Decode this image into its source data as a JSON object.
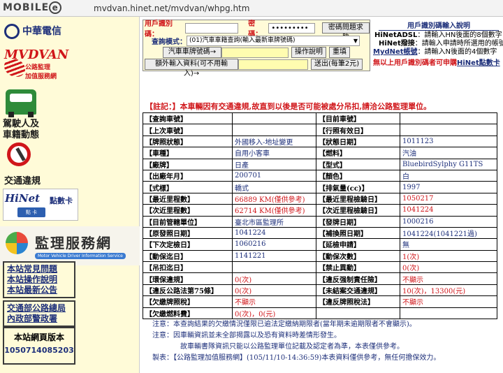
{
  "browser": {
    "logo_text": "MOBILE",
    "logo_mark": "e",
    "url": "mvdvan.hinet.net/mvdvan/whpg.htm"
  },
  "sidebar": {
    "cht_logo": "中華電信",
    "mvdvan": {
      "title": "MVDVAN",
      "sub1": "公路監理",
      "sub2": "加值服務網"
    },
    "driver_label": [
      "駕駛人及",
      "車籍動態"
    ],
    "traffic_label": "交通違規",
    "hinet": {
      "name": "HiNet",
      "points": "點數卡",
      "card": "點 卡"
    },
    "service": {
      "title": "監理服務網",
      "en": "Motor Vehicle Driver Information Service"
    },
    "links_1": [
      "本站常見問題",
      "本站操作說明",
      "本站最新公告"
    ],
    "links_2": [
      "交通部公路總局",
      "內政部警政署"
    ],
    "version": {
      "title": "本站網頁版本",
      "value": "1050714085203"
    }
  },
  "form": {
    "user_id_label": "用戶識別碼：",
    "user_id_value": "",
    "password_label": "密碼：",
    "password_value": "•••••••••",
    "hint_button": "密碼問題求助",
    "mode_label": "查詢模式：",
    "mode_value": "(01)汽車車籍查詢(輸入最新車牌號碼)",
    "plate_button": "汽車車牌號碼→",
    "plate_value": "",
    "help_button": "操作說明",
    "reset_button": "重填",
    "extra_button": "額外輸入資料(可不用輸入)→",
    "extra_value": "",
    "submit_button": "送出(每筆2元)"
  },
  "instructions": {
    "title": "用戶識別碼輸入說明",
    "lines": [
      {
        "key": "HiNetADSL",
        "text": "：請輸入HN後面的8個數字"
      },
      {
        "key": "HiNet撥接",
        "text": "：請輸入申請時所選用的帳號"
      },
      {
        "key": "MydNet帳號",
        "text": "：請輸入N後面的4個數字"
      }
    ],
    "note": "無以上用戶識別碼者可申購",
    "note_link": "HiNet點數卡"
  },
  "result": {
    "warning": "【註記：】本車輛因有交通違規,故直到以後是否可能被處分吊扣,請洽公路監理單位。",
    "rows": [
      {
        "l1": "【查詢車號】",
        "v1": "",
        "l2": "【目前車號】",
        "v2": ""
      },
      {
        "l1": "【上次車號】",
        "v1": "",
        "l2": "【行照有效日】",
        "v2": ""
      },
      {
        "l1": "【牌照狀態】",
        "v1": "外國移入-地址變更",
        "l2": "【狀態日期】",
        "v2": "1011123"
      },
      {
        "l1": "【車種】",
        "v1": "自用小客車",
        "l2": "【燃料】",
        "v2": "汽油"
      },
      {
        "l1": "【廠牌】",
        "v1": "日產",
        "l2": "【型式】",
        "v2": "BluebirdSylphy G11TS"
      },
      {
        "l1": "【出廠年月】",
        "v1": "200701",
        "l2": "【顏色】",
        "v2": "白"
      },
      {
        "l1": "【式樣】",
        "v1": "轎式",
        "l2": "【排氣量(cc)】",
        "v2": "1997"
      },
      {
        "l1": "【最近里程數】",
        "v1": "66889 KM(僅供參考)",
        "l2": "【最近里程檢驗日】",
        "v2": "1050217",
        "r1": true,
        "r2": true
      },
      {
        "l1": "【次近里程數】",
        "v1": "62714 KM(僅供參考)",
        "l2": "【次近里程檢驗日】",
        "v2": "1041224",
        "r1": true,
        "r2": true
      },
      {
        "l1": "【目前管轄單位】",
        "v1": "臺北市區監理所",
        "l2": "【發牌日期】",
        "v2": "1000216"
      },
      {
        "l1": "【原發照日期】",
        "v1": "1041224",
        "l2": "【補換照日期】",
        "v2": "1041224(1041221過)"
      },
      {
        "l1": "【下次定檢日】",
        "v1": "1060216",
        "l2": "【延檢申請】",
        "v2": "無"
      },
      {
        "l1": "【動保迄日】",
        "v1": "1141221",
        "l2": "【動保次數】",
        "v2": "1(次)",
        "r2": true
      },
      {
        "l1": "【吊扣迄日】",
        "v1": "",
        "l2": "【禁止異動】",
        "v2": "0(次)",
        "r2": true
      },
      {
        "l1": "【環保違規】",
        "v1": "0(次)",
        "l2": "【違反强制責任險】",
        "v2": "不顯示",
        "r1": true,
        "r2": true
      },
      {
        "l1": "【違反公路法第75條】",
        "v1": "0(次)",
        "l2": "【未結案交通違規】",
        "v2": "10(次)，13300(元)",
        "r1": true,
        "r2": true
      },
      {
        "l1": "【欠繳牌照稅】",
        "v1": "不顯示",
        "l2": "【違反牌照稅法】",
        "v2": "不顯示",
        "r1": true,
        "r2": true
      },
      {
        "l1": "【欠繳燃料費】",
        "v1": "0(次)，0(元)",
        "l2": "",
        "v2": "",
        "r1": true
      }
    ],
    "notices": [
      "注意：本查詢結果的欠繳情況僅限已逾法定繳納期限者(當年期未逾期限者不會顯示)。",
      "注意：因車輛資訊並未全部揭露以及恐有資料時差情形發生。",
      "故車輛書隊資訊只能以公路監理單位記載及認定者為準，本表僅供參考。",
      "製表：【公路監理加值服務網】(105/11/10-14:36:59)本表資料僅供參考，無任何擔保效力。"
    ]
  }
}
